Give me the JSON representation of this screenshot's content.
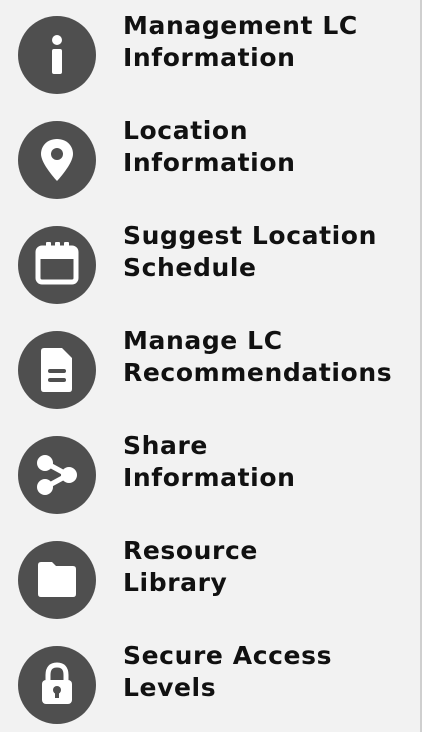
{
  "theme": {
    "icon_bg": "#4f4f4f",
    "icon_fg": "#ffffff",
    "panel_bg": "#f2f2f2",
    "text": "#111111"
  },
  "menu": {
    "items": [
      {
        "icon": "info-icon",
        "line1": "Management LC",
        "line2": "Information"
      },
      {
        "icon": "location-pin-icon",
        "line1": "Location",
        "line2": "Information"
      },
      {
        "icon": "calendar-icon",
        "line1": "Suggest Location",
        "line2": "Schedule"
      },
      {
        "icon": "document-icon",
        "line1": "Manage LC",
        "line2": "Recommendations"
      },
      {
        "icon": "share-icon",
        "line1": "Share",
        "line2": "Information"
      },
      {
        "icon": "folder-icon",
        "line1": "Resource",
        "line2": "Library"
      },
      {
        "icon": "lock-icon",
        "line1": "Secure Access",
        "line2": "Levels"
      }
    ]
  }
}
